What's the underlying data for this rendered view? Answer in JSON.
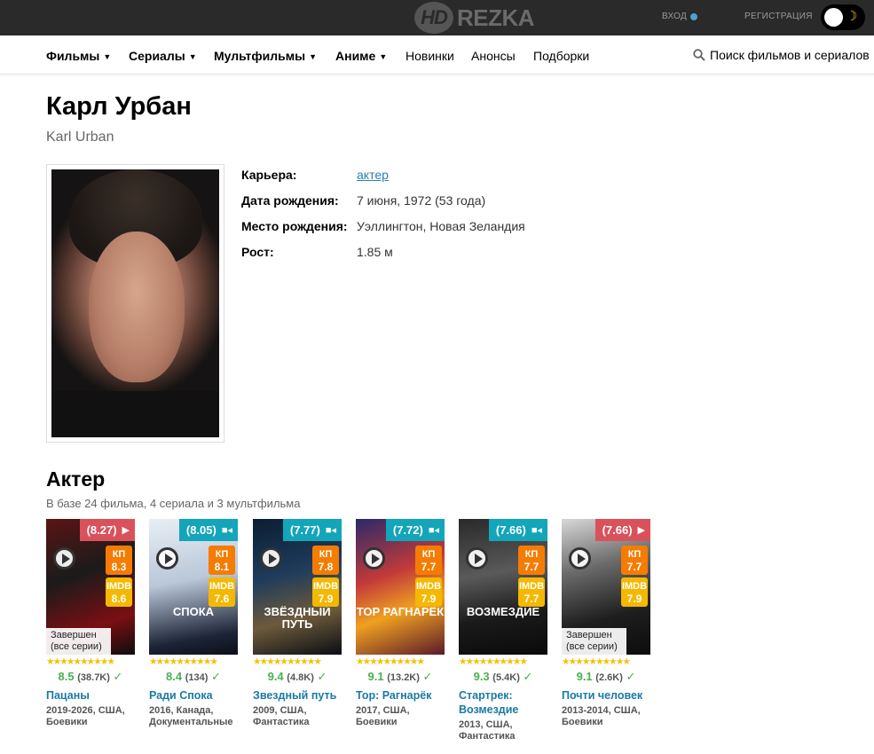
{
  "topbar": {
    "logo_hd": "HD",
    "logo_text": "REZKA",
    "login": "ВХОД",
    "register": "РЕГИСТРАЦИЯ"
  },
  "nav": {
    "films": "Фильмы",
    "series": "Сериалы",
    "cartoons": "Мультфильмы",
    "anime": "Аниме",
    "new": "Новинки",
    "announcements": "Анонсы",
    "collections": "Подборки",
    "search": "Поиск фильмов и сериалов"
  },
  "person": {
    "name_ru": "Карл Урбан",
    "name_en": "Karl Urban",
    "info": {
      "career_label": "Карьера:",
      "career_value": "актер",
      "birthdate_label": "Дата рождения:",
      "birthdate_value": "7 июня, 1972 (53 года)",
      "birthplace_label": "Место рождения:",
      "birthplace_value": "Уэллингтон, Новая Зеландия",
      "height_label": "Рост:",
      "height_value": "1.85 м"
    }
  },
  "section": {
    "title": "Актер",
    "subtitle": "В базе 24 фильма, 4 сериала и 3 мультфильма"
  },
  "cards": [
    {
      "badge": "(8.27)",
      "badge_color": "red",
      "badge_icon": "youtube-icon",
      "kp_label": "КП",
      "kp": "8.3",
      "imdb_label": "IMDB",
      "imdb": "8.6",
      "status_line1": "Завершен",
      "status_line2": "(все серии)",
      "rating": "8.5",
      "count": "(38.7K)",
      "check": "✓",
      "title": "Пацаны",
      "meta_line1": "2019-2026, США,",
      "meta_line2": "Боевики",
      "poster_text": "",
      "stars": "★★★★★★★★★★"
    },
    {
      "badge": "(8.05)",
      "badge_color": "teal",
      "badge_icon": "camera-icon",
      "kp_label": "КП",
      "kp": "8.1",
      "imdb_label": "IMDB",
      "imdb": "7.6",
      "status_line1": "",
      "status_line2": "",
      "rating": "8.4",
      "count": "(134)",
      "check": "✓",
      "title": "Ради Спока",
      "meta_line1": "2016, Канада,",
      "meta_line2": "Документальные",
      "poster_text": "СПОКА",
      "stars": "★★★★★★★★★★"
    },
    {
      "badge": "(7.77)",
      "badge_color": "teal",
      "badge_icon": "camera-icon",
      "kp_label": "КП",
      "kp": "7.8",
      "imdb_label": "IMDB",
      "imdb": "7.9",
      "status_line1": "",
      "status_line2": "",
      "rating": "9.4",
      "count": "(4.8K)",
      "check": "✓",
      "title": "Звездный путь",
      "meta_line1": "2009, США,",
      "meta_line2": "Фантастика",
      "poster_text": "ЗВЁЗДНЫЙ ПУТЬ",
      "stars": "★★★★★★★★★★"
    },
    {
      "badge": "(7.72)",
      "badge_color": "teal",
      "badge_icon": "camera-icon",
      "kp_label": "КП",
      "kp": "7.7",
      "imdb_label": "IMDB",
      "imdb": "7.9",
      "status_line1": "",
      "status_line2": "",
      "rating": "9.1",
      "count": "(13.2K)",
      "check": "✓",
      "title": "Тор: Рагнарёк",
      "meta_line1": "2017, США,",
      "meta_line2": "Боевики",
      "poster_text": "ТОР РАГНАРЁК",
      "stars": "★★★★★★★★★★"
    },
    {
      "badge": "(7.66)",
      "badge_color": "teal",
      "badge_icon": "camera-icon",
      "kp_label": "КП",
      "kp": "7.7",
      "imdb_label": "IMDB",
      "imdb": "7.7",
      "status_line1": "",
      "status_line2": "",
      "rating": "9.3",
      "count": "(5.4K)",
      "check": "✓",
      "title": "Стартрек: Возмездие",
      "meta_line1": "2013, США,",
      "meta_line2": "Фантастика",
      "poster_text": "ВОЗМЕЗДИЕ",
      "stars": "★★★★★★★★★★"
    },
    {
      "badge": "(7.66)",
      "badge_color": "red",
      "badge_icon": "youtube-icon",
      "kp_label": "КП",
      "kp": "7.7",
      "imdb_label": "IMDB",
      "imdb": "7.9",
      "status_line1": "Завершен",
      "status_line2": "(все серии)",
      "rating": "9.1",
      "count": "(2.6K)",
      "check": "✓",
      "title": "Почти человек",
      "meta_line1": "2013-2014, США,",
      "meta_line2": "Боевики",
      "poster_text": "",
      "stars": "★★★★★★★★★★"
    }
  ]
}
